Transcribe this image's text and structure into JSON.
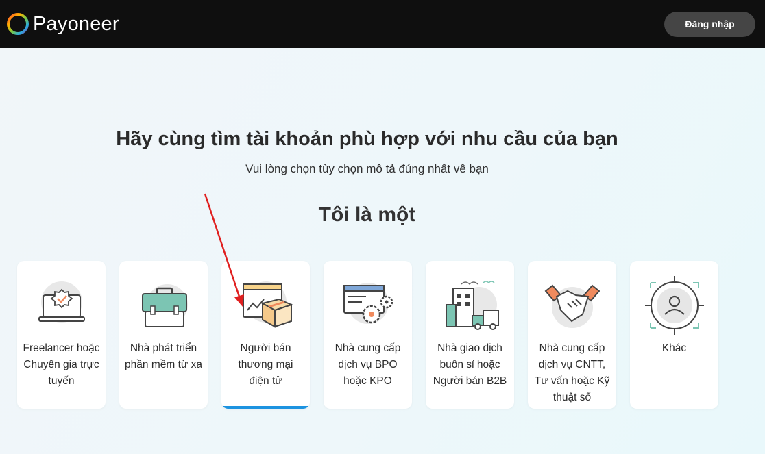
{
  "header": {
    "brand": "Payoneer",
    "login_label": "Đăng nhập"
  },
  "main": {
    "title": "Hãy cùng tìm tài khoản phù hợp với nhu cầu của bạn",
    "subtitle": "Vui lòng chọn tùy chọn mô tả đúng nhất về bạn",
    "prompt": "Tôi là một"
  },
  "cards": [
    {
      "label": "Freelancer hoặc Chuyên gia trực tuyến",
      "icon": "laptop-badge-icon"
    },
    {
      "label": "Nhà phát triển phần mềm từ xa",
      "icon": "briefcase-icon"
    },
    {
      "label": "Người bán thương mại điện tử",
      "icon": "ecommerce-box-icon",
      "selected": true
    },
    {
      "label": "Nhà cung cấp dịch vụ BPO hoặc KPO",
      "icon": "window-gears-icon"
    },
    {
      "label": "Nhà giao dịch buôn sỉ hoặc Người bán B2B",
      "icon": "factory-truck-icon"
    },
    {
      "label": "Nhà cung cấp dịch vụ CNTT, Tư vấn hoặc Kỹ thuật số",
      "icon": "handshake-icon"
    },
    {
      "label": "Khác",
      "icon": "user-target-icon"
    }
  ],
  "colors": {
    "header_bg": "#0f0f0f",
    "login_bg": "#454545",
    "accent_selected": "#1c93e0",
    "annotation_arrow": "#e02020",
    "icon_teal": "#7cc5b3",
    "icon_orange": "#f08a5d"
  }
}
